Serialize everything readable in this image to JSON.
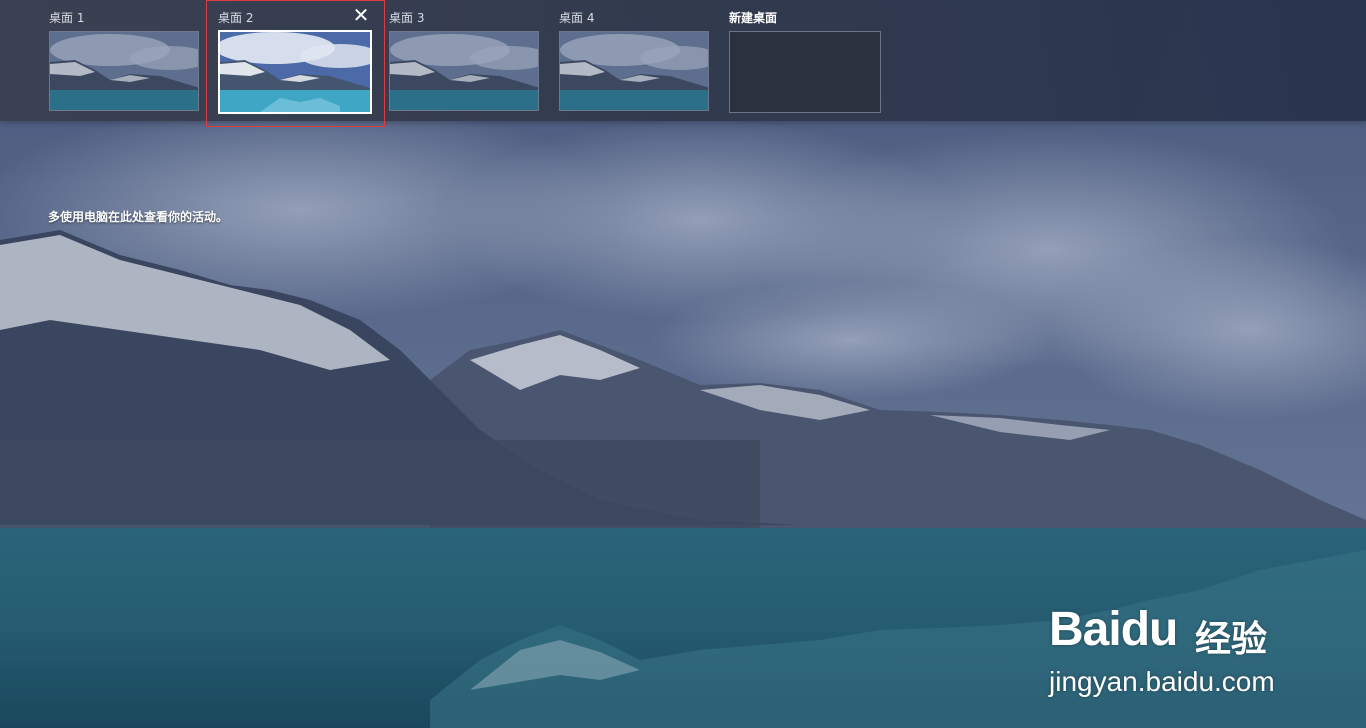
{
  "desktops": [
    {
      "label": "桌面 1"
    },
    {
      "label": "桌面 2"
    },
    {
      "label": "桌面 3"
    },
    {
      "label": "桌面 4"
    }
  ],
  "new_desktop": {
    "label": "新建桌面"
  },
  "close_glyph": "✕",
  "activity_message": "多使用电脑在此处查看你的活动。",
  "watermark": {
    "logo": "Bai",
    "logo_tail": "du",
    "cn": "经验",
    "url": "jingyan.baidu.com"
  },
  "colors": {
    "focus_ring": "#e0393e",
    "active_border": "#ffffff",
    "bar_bg": "#343c4e"
  }
}
